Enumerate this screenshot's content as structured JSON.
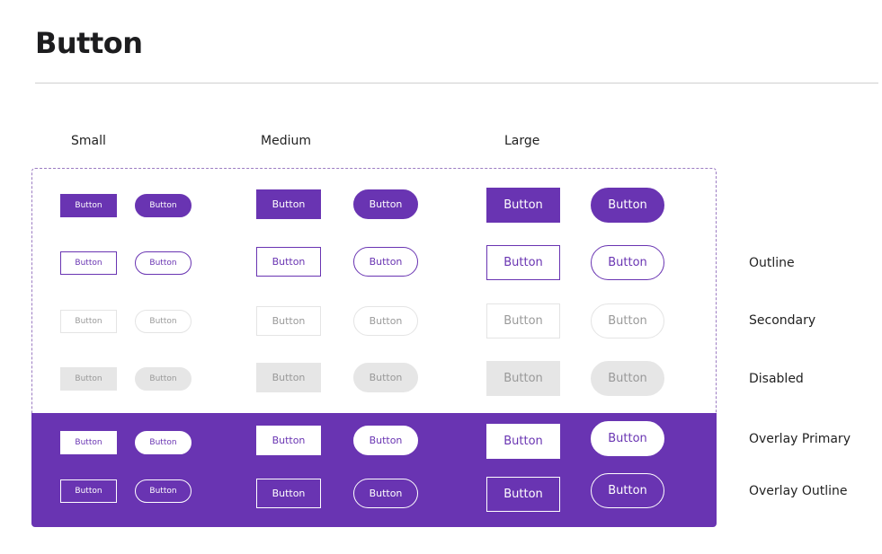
{
  "page": {
    "title": "Button"
  },
  "columns": {
    "small": "Small",
    "medium": "Medium",
    "large": "Large"
  },
  "rows": {
    "outline": "Outline",
    "secondary": "Secondary",
    "disabled": "Disabled",
    "overlay_primary": "Overlay Primary",
    "overlay_outline": "Overlay Outline"
  },
  "button_label": "Button",
  "colors": {
    "brand": "#6934b2",
    "secondary_border": "#e4e4e4",
    "disabled_fill": "#e6e6e6",
    "text_on_brand": "#ffffff"
  }
}
